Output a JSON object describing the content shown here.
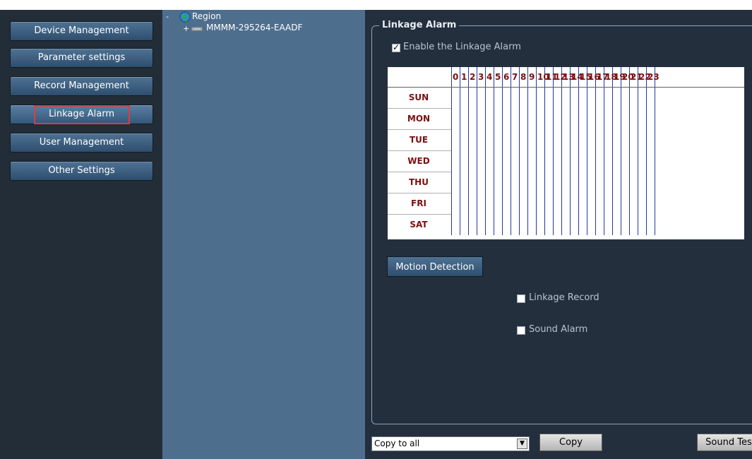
{
  "nav": {
    "items": [
      {
        "label": "Device Management"
      },
      {
        "label": "Parameter settings"
      },
      {
        "label": "Record Management"
      },
      {
        "label": "Linkage Alarm"
      },
      {
        "label": "User Management"
      },
      {
        "label": "Other Settings"
      }
    ],
    "selected_index": 3
  },
  "tree": {
    "root": {
      "label": "Region",
      "toggle": "-"
    },
    "children": [
      {
        "label": "MMMM-295264-EAADF",
        "toggle": "+"
      }
    ]
  },
  "linkage": {
    "legend": "Linkage Alarm",
    "enable_label": "Enable the Linkage Alarm",
    "enable_checked": true,
    "schedule": {
      "hours": [
        "0",
        "1",
        "2",
        "3",
        "4",
        "5",
        "6",
        "7",
        "8",
        "9",
        "10",
        "11",
        "12",
        "13",
        "14",
        "15",
        "16",
        "17",
        "18",
        "19",
        "20",
        "21",
        "22",
        "23"
      ],
      "days": [
        "SUN",
        "MON",
        "TUE",
        "WED",
        "THU",
        "FRI",
        "SAT"
      ]
    },
    "motion_button": "Motion Detection",
    "record_label": "Linkage Record",
    "record_checked": false,
    "sound_label": "Sound Alarm",
    "sound_checked": false
  },
  "footer": {
    "copy_select_value": "Copy to all",
    "copy_button": "Copy",
    "sound_test_button": "Sound Test"
  },
  "colors": {
    "highlight_border": "#e03c3c",
    "day_label": "#7a1010",
    "grid_line": "#1e3aa0"
  }
}
